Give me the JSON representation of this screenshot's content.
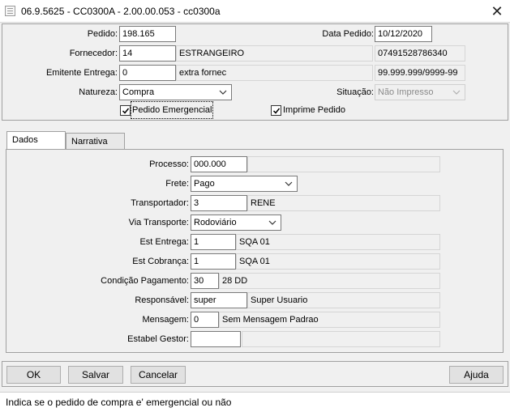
{
  "window": {
    "title": "06.9.5625 - CC0300A - 2.00.00.053 - cc0300a",
    "close_glyph": "✕",
    "icon": "app-window-icon"
  },
  "header": {
    "pedido": {
      "label": "Pedido:",
      "value": "198.165"
    },
    "data_pedido": {
      "label": "Data Pedido:",
      "value": "10/12/2020"
    },
    "fornecedor": {
      "label": "Fornecedor:",
      "code": "14",
      "name": "ESTRANGEIRO",
      "document": "07491528786340"
    },
    "emitente_entrega": {
      "label": "Emitente Entrega:",
      "code": "0",
      "name": "extra fornec",
      "document": "99.999.999/9999-99"
    },
    "natureza": {
      "label": "Natureza:",
      "value": "Compra"
    },
    "situacao": {
      "label": "Situação:",
      "value": "Não Impresso"
    },
    "pedido_emergencial": {
      "label": "Pedido Emergencial",
      "checked": true
    },
    "imprime_pedido": {
      "label": "Imprime Pedido",
      "checked": true
    }
  },
  "tabs": [
    {
      "label": "Dados",
      "active": true
    },
    {
      "label": "Narrativa",
      "active": false
    }
  ],
  "dados": {
    "processo": {
      "label": "Processo:",
      "value": "000.000"
    },
    "frete": {
      "label": "Frete:",
      "value": "Pago"
    },
    "transportador": {
      "label": "Transportador:",
      "code": "3",
      "name": "RENE"
    },
    "via_transporte": {
      "label": "Via Transporte:",
      "value": "Rodoviário"
    },
    "est_entrega": {
      "label": "Est Entrega:",
      "code": "1",
      "name": "SQA 01"
    },
    "est_cobranca": {
      "label": "Est Cobrança:",
      "code": "1",
      "name": "SQA 01"
    },
    "condicao_pagamento": {
      "label": "Condição Pagamento:",
      "code": "30",
      "name": "28 DD"
    },
    "responsavel": {
      "label": "Responsável:",
      "code": "super",
      "name": "Super Usuario"
    },
    "mensagem": {
      "label": "Mensagem:",
      "code": "0",
      "name": "Sem Mensagem Padrao"
    },
    "estabel_gestor": {
      "label": "Estabel Gestor:",
      "code": "",
      "name": ""
    }
  },
  "buttons": {
    "ok": "OK",
    "salvar": "Salvar",
    "cancelar": "Cancelar",
    "ajuda": "Ajuda"
  },
  "status": "Indica se o pedido de compra e' emergencial ou não",
  "colors": {
    "background": "#f0f0f0",
    "border": "#a0a0a0",
    "input_border": "#7a7a7a",
    "disabled_text": "#8a8a8a"
  }
}
